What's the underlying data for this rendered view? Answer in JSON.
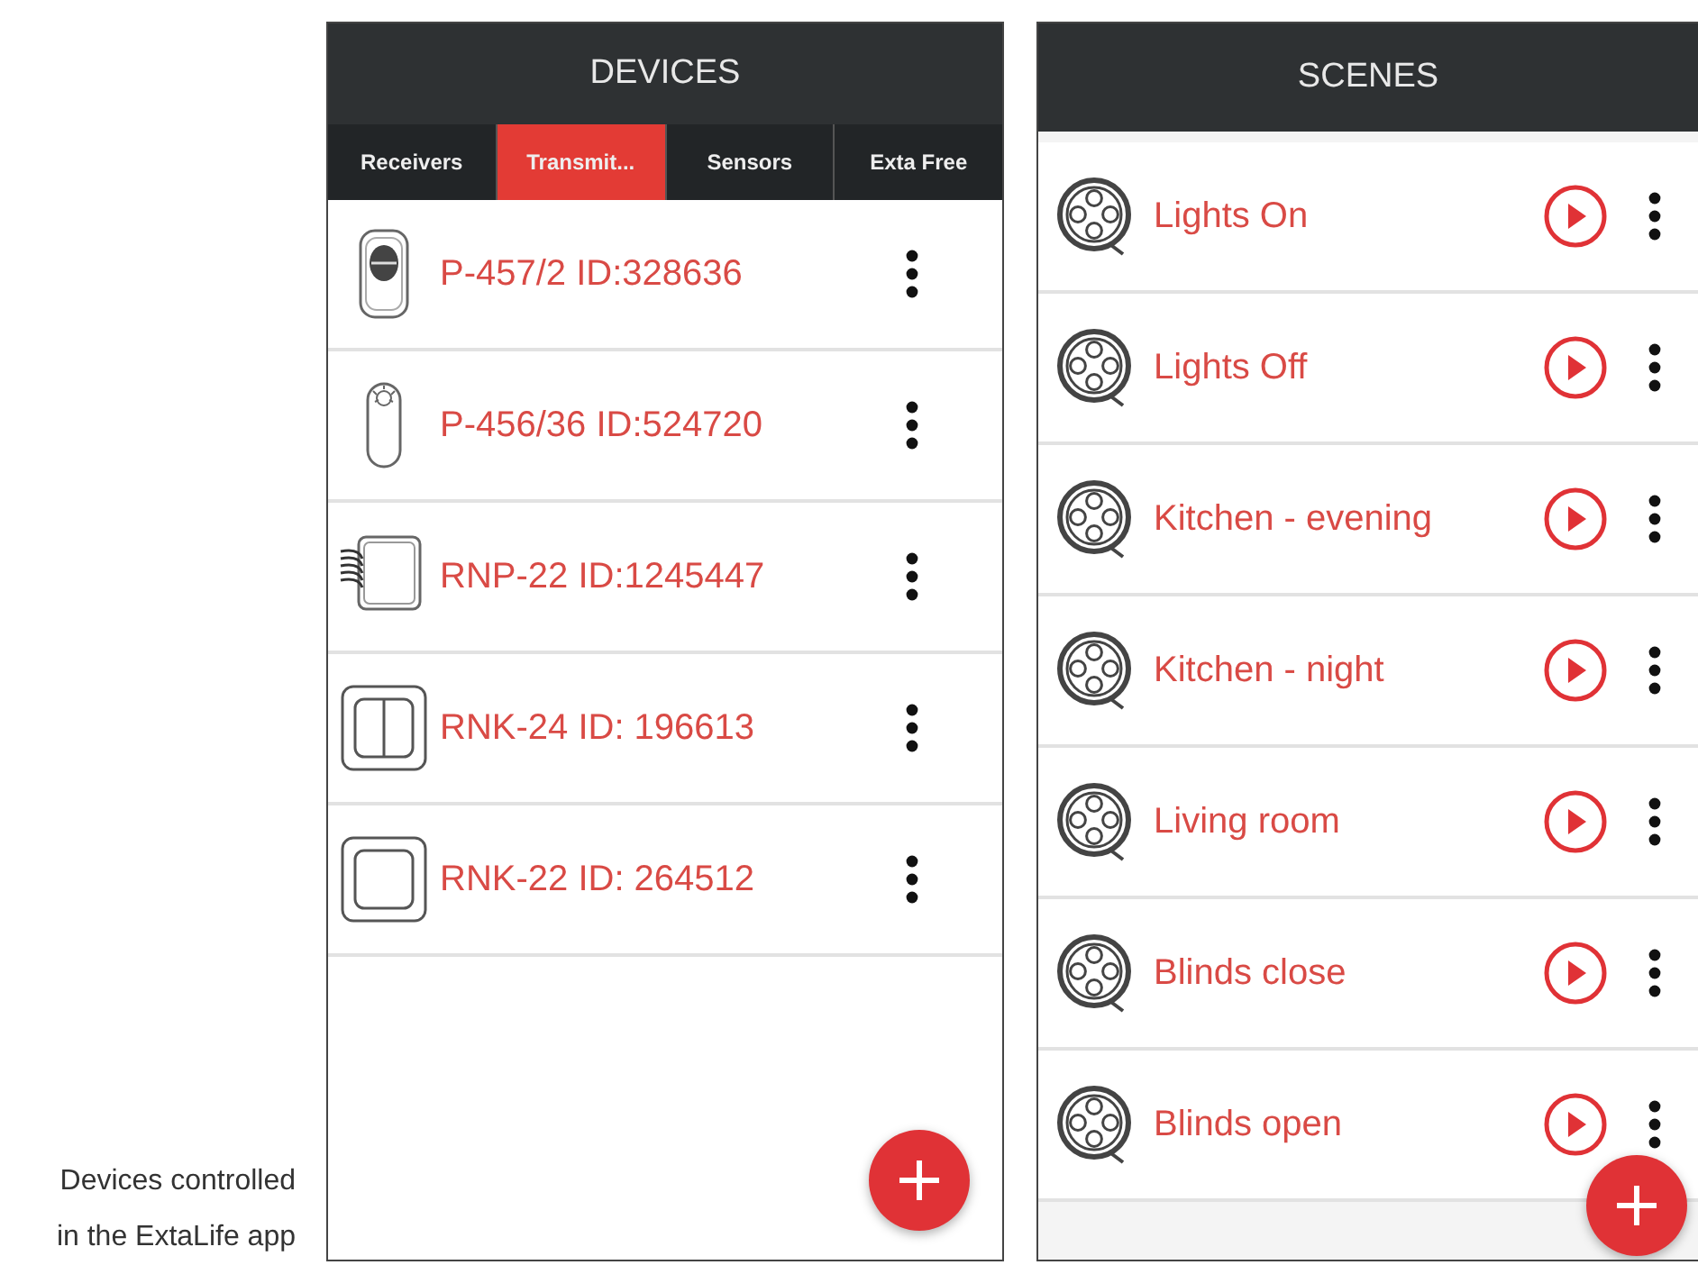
{
  "caption": "Devices controlled in the ExtaLife app",
  "devices": {
    "title": "DEVICES",
    "tabs": [
      {
        "label": "Receivers",
        "selected": false
      },
      {
        "label": "Transmit...",
        "selected": true
      },
      {
        "label": "Sensors",
        "selected": false
      },
      {
        "label": "Exta Free",
        "selected": false
      }
    ],
    "rows": [
      {
        "kind": "remote",
        "name": "P-457/2 ID:328636"
      },
      {
        "kind": "pendant",
        "name": "P-456/36 ID:524720"
      },
      {
        "kind": "wired-panel",
        "name": "RNP-22 ID:1245447"
      },
      {
        "kind": "double-switch",
        "name": "RNK-24 ID: 196613"
      },
      {
        "kind": "single-switch",
        "name": "RNK-22 ID: 264512"
      }
    ]
  },
  "scenes": {
    "title": "SCENES",
    "rows": [
      {
        "name": "Lights On"
      },
      {
        "name": "Lights Off"
      },
      {
        "name": "Kitchen - evening"
      },
      {
        "name": "Kitchen - night"
      },
      {
        "name": "Living room"
      },
      {
        "name": "Blinds close"
      },
      {
        "name": "Blinds open"
      }
    ]
  }
}
